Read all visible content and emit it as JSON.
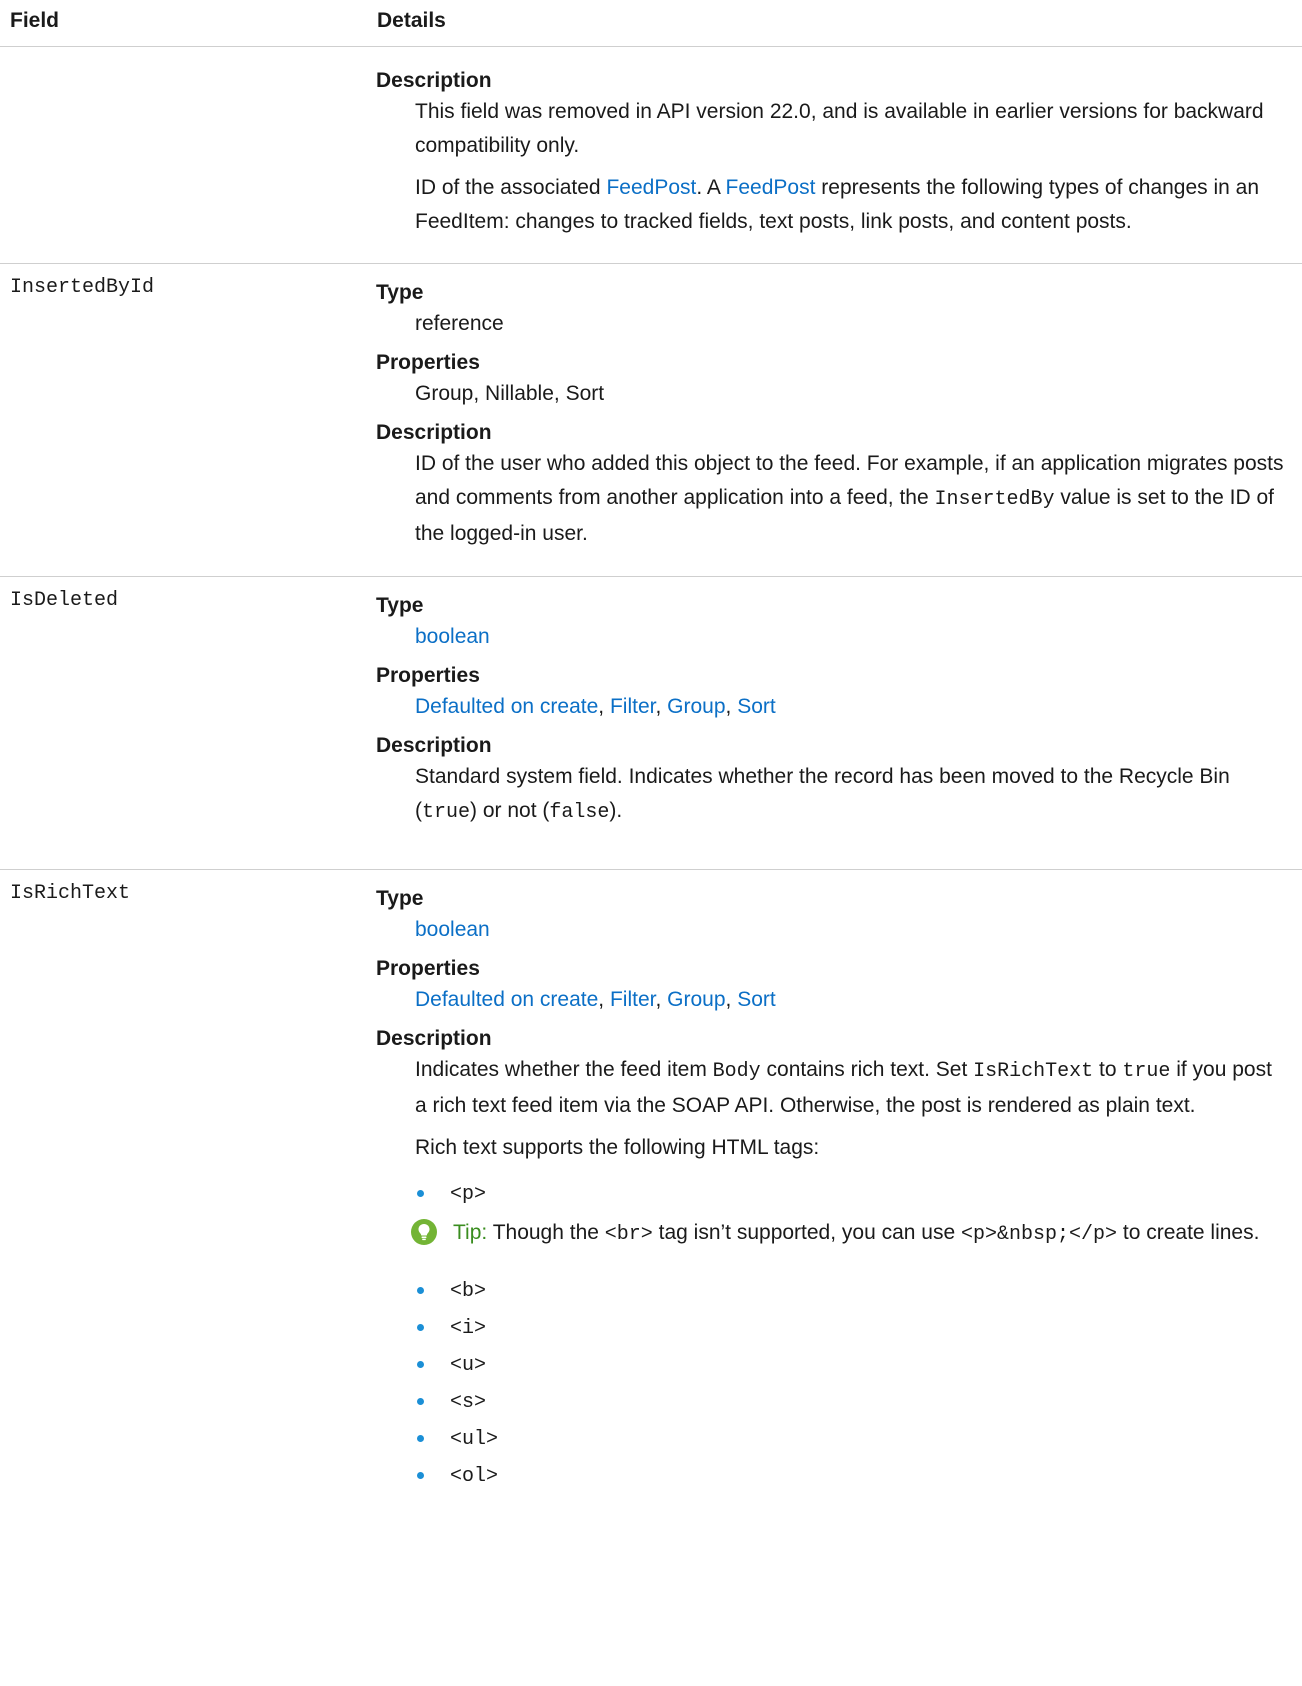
{
  "header": {
    "field": "Field",
    "details": "Details"
  },
  "row0": {
    "description_label": "Description",
    "desc_p1": "This field was removed in API version 22.0, and is available in earlier versions for backward compatibility only.",
    "desc_p2_a": "ID of the associated ",
    "desc_p2_link1": "FeedPost",
    "desc_p2_b": ". A ",
    "desc_p2_link2": "FeedPost",
    "desc_p2_c": " represents the following types of changes in an FeedItem: changes to tracked fields, text posts, link posts, and content posts."
  },
  "inserted_by": {
    "name": "InsertedById",
    "type_label": "Type",
    "type_value": "reference",
    "props_label": "Properties",
    "props_value": "Group, Nillable, Sort",
    "desc_label": "Description",
    "desc_a": "ID of the user who added this object to the feed. For example, if an application migrates posts and comments from another application into a feed, the ",
    "desc_code": "InsertedBy",
    "desc_b": " value is set to the ID of the logged-in user."
  },
  "is_deleted": {
    "name": "IsDeleted",
    "type_label": "Type",
    "type_value": "boolean",
    "props_label": "Properties",
    "props": [
      "Defaulted on create",
      "Filter",
      "Group",
      "Sort"
    ],
    "desc_label": "Description",
    "desc_a": "Standard system field. Indicates whether the record has been moved to the Recycle Bin (",
    "desc_code1": "true",
    "desc_b": ") or not (",
    "desc_code2": "false",
    "desc_c": ")."
  },
  "is_rich_text": {
    "name": "IsRichText",
    "type_label": "Type",
    "type_value": "boolean",
    "props_label": "Properties",
    "props": [
      "Defaulted on create",
      "Filter",
      "Group",
      "Sort"
    ],
    "desc_label": "Description",
    "desc_a": "Indicates whether the feed item ",
    "desc_code1": "Body",
    "desc_b": " contains rich text. Set ",
    "desc_code2": "IsRichText",
    "desc_c": " to ",
    "desc_code3": "true",
    "desc_d": " if you post a rich text feed item via the SOAP API. Otherwise, the post is rendered as plain text.",
    "supports_text": "Rich text supports the following HTML tags:",
    "tags": [
      "<p>",
      "<b>",
      "<i>",
      "<u>",
      "<s>",
      "<ul>",
      "<ol>"
    ],
    "tip_label": "Tip:",
    "tip_a": " Though the ",
    "tip_code1": "<br>",
    "tip_b": " tag isn’t supported, you can use ",
    "tip_code2": "<p>&nbsp;</p>",
    "tip_c": " to create lines.",
    "sep": ", "
  },
  "colors": {
    "link": "#0b6fc6",
    "bullet": "#1b8fd6",
    "tip_icon": "#73b435",
    "tip_label": "#3a8d1f",
    "border": "#cfcfcf"
  }
}
